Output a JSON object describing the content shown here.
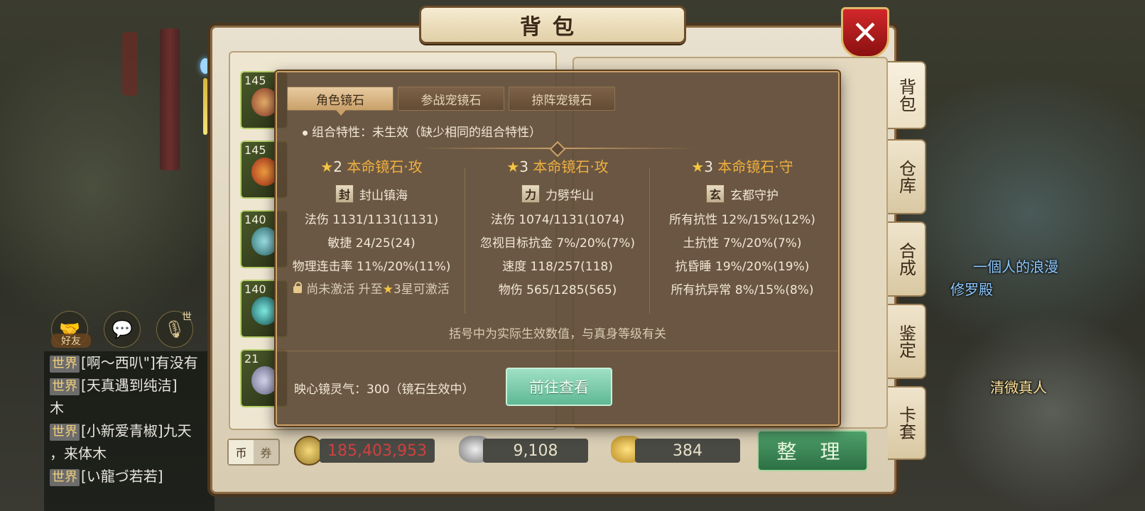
{
  "window": {
    "title": "背包",
    "close_label": "✕"
  },
  "side_tabs": [
    {
      "label": "背包",
      "active": true
    },
    {
      "label": "仓库",
      "active": false
    },
    {
      "label": "合成",
      "active": false
    },
    {
      "label": "鉴定",
      "active": false
    },
    {
      "label": "卡套",
      "active": false
    }
  ],
  "inventory_levels": [
    "145",
    "145",
    "140",
    "140",
    "21"
  ],
  "popup": {
    "tabs": [
      "角色镜石",
      "参战宠镜石",
      "掠阵宠镜石"
    ],
    "active_tab": 0,
    "combo_text": "组合特性：未生效（缺少相同的组合特性）",
    "columns": [
      {
        "stars": "2",
        "title": "本命镜石·攻",
        "skill_badge": "封",
        "skill_name": "封山镇海",
        "attrs": [
          "法伤 1131/1131(1131)",
          "敏捷 24/25(24)",
          "物理连击率 11%/20%(11%)"
        ],
        "lock_text": "尚未激活  升至",
        "lock_suffix": "3星可激活"
      },
      {
        "stars": "3",
        "title": "本命镜石·攻",
        "skill_badge": "力",
        "skill_name": "力劈华山",
        "attrs": [
          "法伤 1074/1131(1074)",
          "忽视目标抗金 7%/20%(7%)",
          "速度 118/257(118)",
          "物伤 565/1285(565)"
        ]
      },
      {
        "stars": "3",
        "title": "本命镜石·守",
        "skill_badge": "玄",
        "skill_name": "玄都守护",
        "attrs": [
          "所有抗性 12%/15%(12%)",
          "土抗性 7%/20%(7%)",
          "抗昏睡 19%/20%(19%)",
          "所有抗异常 8%/15%(8%)"
        ]
      }
    ],
    "note": "括号中为实际生效数值，与真身等级有关",
    "spirit_text": "映心镜灵气：300（镜石生效中）",
    "go_button": "前往查看"
  },
  "currency": {
    "toggle": [
      "币",
      "券"
    ],
    "coins": "185,403,953",
    "silver": "9,108",
    "gold": "384"
  },
  "tidy_button": "整 理",
  "hud": {
    "friends_label": "好友",
    "mic_label": "世"
  },
  "chat": [
    {
      "channel": "世界",
      "text": "[啊～西叭\"]有没有"
    },
    {
      "channel": "世界",
      "text": "[天真遇到纯洁]"
    },
    {
      "channel": "",
      "text": "木"
    },
    {
      "channel": "世界",
      "text": "[小新爱青椒]九天"
    },
    {
      "channel": "",
      "text": "，来体木"
    },
    {
      "channel": "世界",
      "text": "[い龍づ若若]"
    }
  ],
  "scene_names": {
    "npc": "清微真人",
    "guild": "修罗殿",
    "player": "一個人的浪漫"
  },
  "colors": {
    "star": "#f4c542",
    "title_orange": "#f0b040",
    "go_button": "#7ccbad",
    "coins_red": "#d04040"
  }
}
